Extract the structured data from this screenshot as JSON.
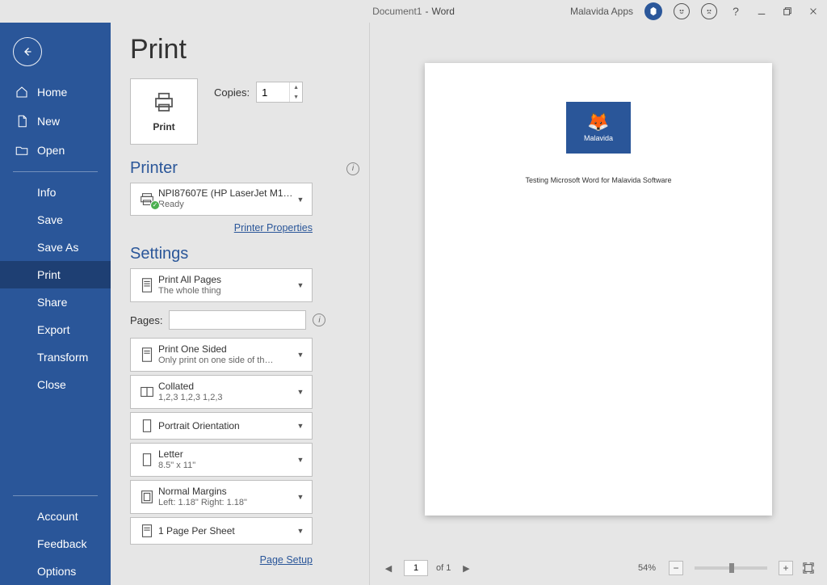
{
  "titlebar": {
    "doc": "Document1",
    "sep": "-",
    "app": "Word",
    "user": "Malavida Apps",
    "help": "?"
  },
  "sidebar": {
    "home": "Home",
    "new": "New",
    "open": "Open",
    "info": "Info",
    "save": "Save",
    "saveas": "Save As",
    "print": "Print",
    "share": "Share",
    "export": "Export",
    "transform": "Transform",
    "close": "Close",
    "account": "Account",
    "feedback": "Feedback",
    "options": "Options"
  },
  "page": {
    "title": "Print"
  },
  "print_tile": {
    "label": "Print"
  },
  "copies": {
    "label": "Copies:",
    "value": "1"
  },
  "printer_section": {
    "title": "Printer"
  },
  "printer": {
    "name": "NPI87607E (HP LaserJet M15…",
    "status": "Ready",
    "properties": "Printer Properties"
  },
  "settings_section": {
    "title": "Settings"
  },
  "settings": {
    "what": {
      "t1": "Print All Pages",
      "t2": "The whole thing"
    },
    "pages_label": "Pages:",
    "sides": {
      "t1": "Print One Sided",
      "t2": "Only print on one side of th…"
    },
    "collate": {
      "t1": "Collated",
      "t2": "1,2,3    1,2,3    1,2,3"
    },
    "orient": {
      "t1": "Portrait Orientation"
    },
    "paper": {
      "t1": "Letter",
      "t2": "8.5\" x 11\""
    },
    "margin": {
      "t1": "Normal Margins",
      "t2": "Left:  1.18\"    Right:  1.18\""
    },
    "pps": {
      "t1": "1 Page Per Sheet"
    },
    "page_setup": "Page Setup"
  },
  "preview": {
    "logo_text": "Malavida",
    "body_text": "Testing Microsoft Word for Malavida Software",
    "page_input": "1",
    "of_text": "of 1",
    "zoom": "54%"
  }
}
